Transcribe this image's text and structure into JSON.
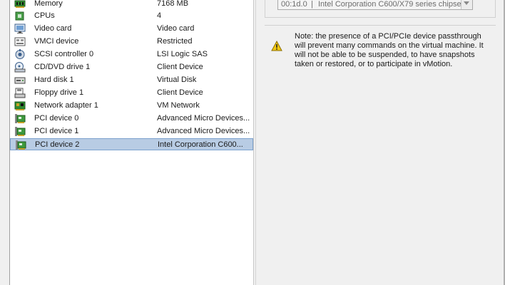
{
  "hardware_list": {
    "items": [
      {
        "name": "Memory",
        "summary": "7168 MB",
        "icon": "memory-icon"
      },
      {
        "name": "CPUs",
        "summary": "4",
        "icon": "cpu-icon"
      },
      {
        "name": "Video card",
        "summary": "Video card",
        "icon": "video-card-icon"
      },
      {
        "name": "VMCI device",
        "summary": "Restricted",
        "icon": "vmci-device-icon"
      },
      {
        "name": "SCSI controller 0",
        "summary": "LSI Logic SAS",
        "icon": "scsi-controller-icon"
      },
      {
        "name": "CD/DVD drive 1",
        "summary": "Client Device",
        "icon": "cd-dvd-drive-icon"
      },
      {
        "name": "Hard disk 1",
        "summary": "Virtual Disk",
        "icon": "hard-disk-icon"
      },
      {
        "name": "Floppy drive 1",
        "summary": "Client Device",
        "icon": "floppy-drive-icon"
      },
      {
        "name": "Network adapter 1",
        "summary": "VM Network",
        "icon": "network-adapter-icon"
      },
      {
        "name": "PCI device 0",
        "summary": "Advanced Micro Devices...",
        "icon": "pci-device-icon"
      },
      {
        "name": "PCI device 1",
        "summary": "Advanced Micro Devices...",
        "icon": "pci-device-icon"
      },
      {
        "name": "PCI device 2",
        "summary": "Intel Corporation C600...",
        "icon": "pci-device-icon",
        "selected": true
      }
    ]
  },
  "pci_device": {
    "device_id": "00:1d.0",
    "separator": "|",
    "device_name": "Intel Corporation C600/X79 series chipset"
  },
  "note": {
    "icon": "warning-icon",
    "text": "Note: the presence of a PCI/PCIe device passthrough will prevent many commands on the virtual machine. It will not be able to be suspended, to have snapshots taken or restored, or to participate in vMotion."
  },
  "colors": {
    "selection_background": "#b8cce4",
    "selection_border": "#7da2ce",
    "warning_yellow": "#f2c811"
  }
}
